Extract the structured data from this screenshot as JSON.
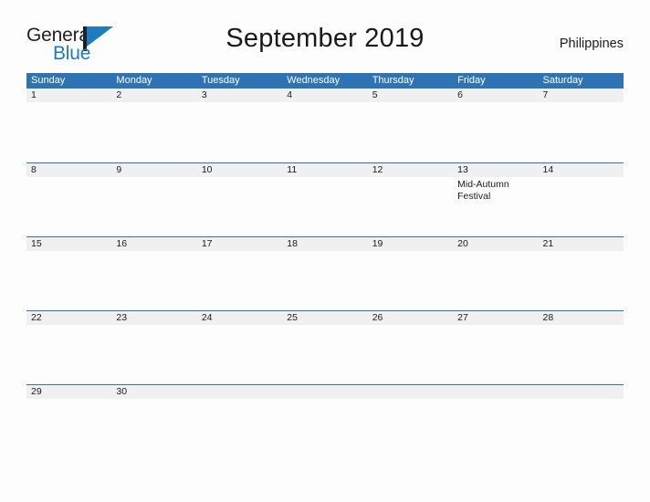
{
  "brand": {
    "line1": "General",
    "line2": "Blue",
    "mark": "blue-flag-logo-icon"
  },
  "header": {
    "title": "September 2019",
    "locale": "Philippines"
  },
  "colors": {
    "header_blue": "#2e74b5",
    "brand_blue": "#1d7bc1",
    "date_band_gray": "#f0f0f0",
    "text": "#1a1a1a",
    "page_background": "#fdfdfd"
  },
  "calendar": {
    "weekdays": [
      "Sunday",
      "Monday",
      "Tuesday",
      "Wednesday",
      "Thursday",
      "Friday",
      "Saturday"
    ],
    "weeks": [
      [
        {
          "date": "1",
          "events": []
        },
        {
          "date": "2",
          "events": []
        },
        {
          "date": "3",
          "events": []
        },
        {
          "date": "4",
          "events": []
        },
        {
          "date": "5",
          "events": []
        },
        {
          "date": "6",
          "events": []
        },
        {
          "date": "7",
          "events": []
        }
      ],
      [
        {
          "date": "8",
          "events": []
        },
        {
          "date": "9",
          "events": []
        },
        {
          "date": "10",
          "events": []
        },
        {
          "date": "11",
          "events": []
        },
        {
          "date": "12",
          "events": []
        },
        {
          "date": "13",
          "events": [
            "Mid-Autumn Festival"
          ]
        },
        {
          "date": "14",
          "events": []
        }
      ],
      [
        {
          "date": "15",
          "events": []
        },
        {
          "date": "16",
          "events": []
        },
        {
          "date": "17",
          "events": []
        },
        {
          "date": "18",
          "events": []
        },
        {
          "date": "19",
          "events": []
        },
        {
          "date": "20",
          "events": []
        },
        {
          "date": "21",
          "events": []
        }
      ],
      [
        {
          "date": "22",
          "events": []
        },
        {
          "date": "23",
          "events": []
        },
        {
          "date": "24",
          "events": []
        },
        {
          "date": "25",
          "events": []
        },
        {
          "date": "26",
          "events": []
        },
        {
          "date": "27",
          "events": []
        },
        {
          "date": "28",
          "events": []
        }
      ],
      [
        {
          "date": "29",
          "events": []
        },
        {
          "date": "30",
          "events": []
        },
        {
          "date": "",
          "events": []
        },
        {
          "date": "",
          "events": []
        },
        {
          "date": "",
          "events": []
        },
        {
          "date": "",
          "events": []
        },
        {
          "date": "",
          "events": []
        }
      ]
    ]
  }
}
